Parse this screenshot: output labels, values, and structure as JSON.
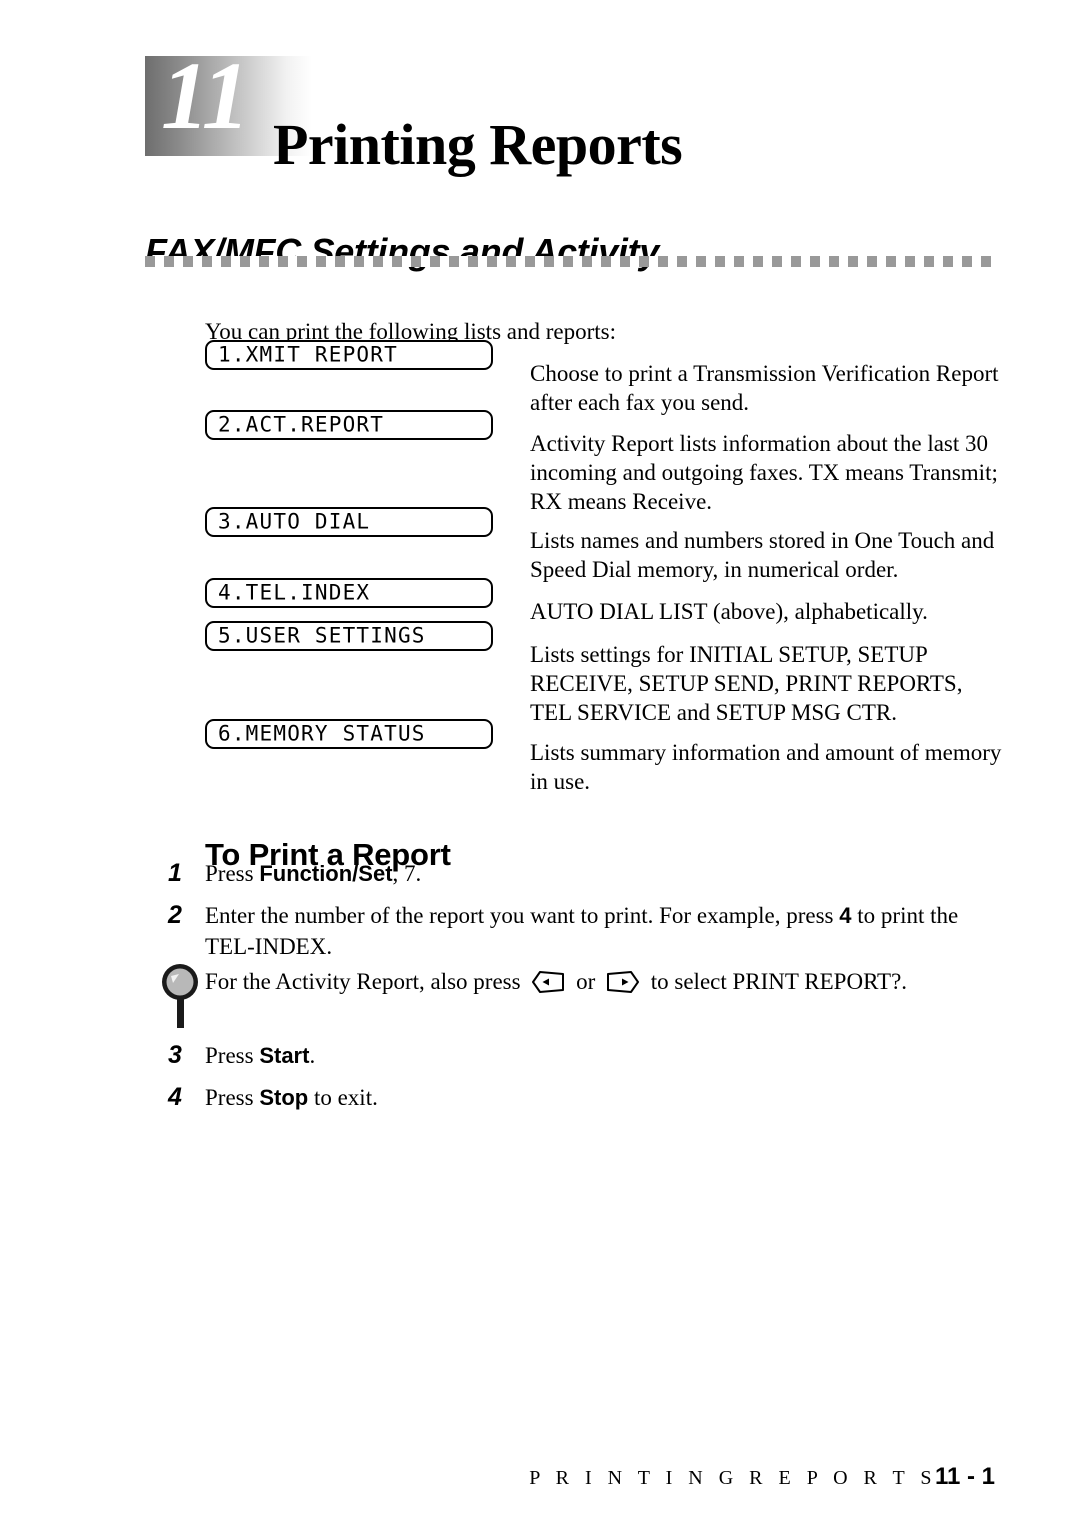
{
  "chapter": {
    "number": "11",
    "title": "Printing Reports"
  },
  "section": {
    "heading": "FAX/MFC Settings and Activity",
    "intro": "You can print the following lists and reports:"
  },
  "reports": [
    {
      "lcd": "1.XMIT REPORT",
      "description": "Choose to print a Transmission Verification Report after each fax you send."
    },
    {
      "lcd": "2.ACT.REPORT",
      "description": "Activity Report lists information about the last 30 incoming and outgoing faxes. TX means Transmit; RX means Receive."
    },
    {
      "lcd": "3.AUTO DIAL",
      "description": "Lists names and numbers stored in One Touch and Speed Dial memory, in numerical order."
    },
    {
      "lcd": "4.TEL.INDEX",
      "description": "AUTO DIAL LIST (above), alphabetically."
    },
    {
      "lcd": "5.USER SETTINGS",
      "description": "Lists settings for INITIAL SETUP, SETUP RECEIVE, SETUP SEND, PRINT REPORTS, TEL SERVICE and SETUP MSG CTR."
    },
    {
      "lcd": "6.MEMORY STATUS",
      "description": " Lists summary information and amount of memory in use."
    }
  ],
  "procedure": {
    "heading": "To Print a Report",
    "steps": [
      {
        "number": "1",
        "text_before": "Press ",
        "key": "Function/Set",
        "text_after": ", 7."
      },
      {
        "number": "2",
        "text_before": "Enter the number of the report you want to print.  For example, press ",
        "key": "4",
        "text_after": " to print the TEL-INDEX."
      },
      {
        "number": "3",
        "text_before": "Press ",
        "key": "Start",
        "text_after": "."
      },
      {
        "number": "4",
        "text_before": "Press ",
        "key": "Stop",
        "text_after": " to exit."
      }
    ]
  },
  "note": {
    "icon": "magnifier-pin-icon",
    "text_before": "For the Activity Report, also press ",
    "left_key_icon": "arrow-left-key-icon",
    "text_middle": " or ",
    "right_key_icon": "arrow-right-key-icon",
    "text_after": " to select PRINT REPORT?."
  },
  "footer": {
    "chapter_name": "P R I N T I N G   R E P O R T S",
    "page_number": "11 - 1"
  },
  "colors": {
    "rule": "#999999",
    "banner_gradient_start": "#6e6e6e",
    "banner_gradient_end": "#ffffff",
    "text": "#000000"
  }
}
